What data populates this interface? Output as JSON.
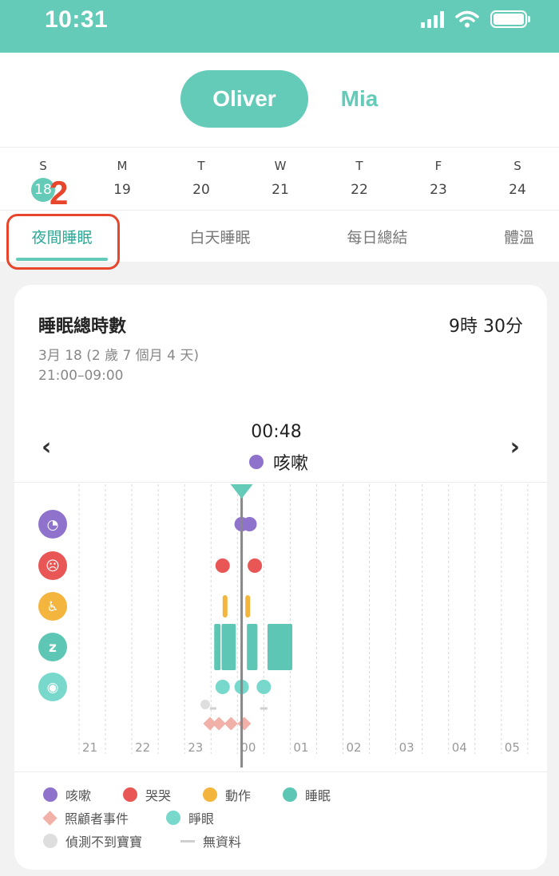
{
  "status_bar": {
    "time": "10:31"
  },
  "profiles": {
    "selected": "Oliver",
    "other": "Mia"
  },
  "week": {
    "days": [
      {
        "letter": "S",
        "num": "18",
        "selected": true
      },
      {
        "letter": "M",
        "num": "19"
      },
      {
        "letter": "T",
        "num": "20"
      },
      {
        "letter": "W",
        "num": "21"
      },
      {
        "letter": "T",
        "num": "22"
      },
      {
        "letter": "F",
        "num": "23"
      },
      {
        "letter": "S",
        "num": "24"
      }
    ]
  },
  "step_badge": "2",
  "tabs": [
    "夜間睡眠",
    "白天睡眠",
    "每日總結",
    "體溫"
  ],
  "card": {
    "title": "睡眠總時數",
    "total": "9時 30分",
    "date": "3月 18 (2 歲 7 個月 4 天)",
    "range": "21:00–09:00",
    "cursor_time": "00:48",
    "cursor_event": "咳嗽"
  },
  "colors": {
    "brand": "#64cbb8",
    "cough": "#8e72cc",
    "cry": "#e85656",
    "motion": "#f3b53d",
    "sleep": "#5ec6b4",
    "awake": "#78d8cc",
    "caregiver": "#f2b1a8",
    "undetected": "#dedede",
    "nodata": "#cfcfcf",
    "highlight": "#e8452d"
  },
  "chart_data": {
    "type": "timeline",
    "x_ticks": [
      "21",
      "22",
      "23",
      "00",
      "01",
      "02",
      "03",
      "04",
      "05"
    ],
    "rows": [
      {
        "id": "cough",
        "icon": "cough-icon",
        "events": [
          0.8,
          2.3
        ]
      },
      {
        "id": "cry",
        "icon": "cry-icon",
        "events": [
          -2.8,
          3.3
        ]
      },
      {
        "id": "motion",
        "icon": "motion-icon",
        "events": [
          {
            "start": -2.8,
            "end": -2.6
          },
          {
            "start": 1.5,
            "end": 2.2
          }
        ]
      },
      {
        "id": "sleep",
        "icon": "sleep-icon",
        "events": [
          {
            "start": -4.4,
            "end": -3.2
          },
          {
            "start": -3.0,
            "end": -0.3
          },
          {
            "start": 1.8,
            "end": 3.8
          },
          {
            "start": 5.7,
            "end": 10.4
          }
        ]
      },
      {
        "id": "awake",
        "icon": "awake-icon",
        "events": [
          -2.8,
          0.8,
          5.0
        ]
      }
    ],
    "undetected": [
      {
        "start": -7.0,
        "end": -5.2
      }
    ],
    "nodata": [
      {
        "start": -5.2,
        "end": -4.0
      },
      {
        "start": 4.3,
        "end": 5.7
      }
    ],
    "caregiver": [
      -5.2,
      -3.5,
      -1.2,
      1.3
    ],
    "cursor": 0.8
  },
  "legend": [
    {
      "shape": "dot",
      "color": "cough",
      "label": "咳嗽"
    },
    {
      "shape": "dot",
      "color": "cry",
      "label": "哭哭"
    },
    {
      "shape": "dot",
      "color": "motion",
      "label": "動作"
    },
    {
      "shape": "dot",
      "color": "sleep",
      "label": "睡眠"
    },
    {
      "shape": "diamond",
      "color": "caregiver",
      "label": "照顧者事件"
    },
    {
      "shape": "dot",
      "color": "awake",
      "label": "睜眼"
    },
    {
      "shape": "dot",
      "color": "undetected",
      "label": "偵測不到寶寶"
    },
    {
      "shape": "line",
      "color": "nodata",
      "label": "無資料"
    }
  ]
}
